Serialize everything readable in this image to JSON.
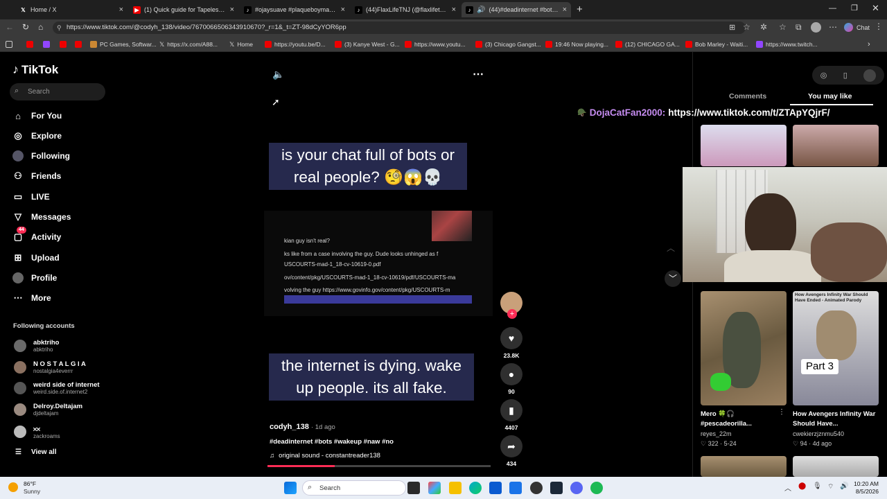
{
  "browser": {
    "tabs": [
      {
        "title": "Home / X",
        "icon": "x-logo-icon"
      },
      {
        "title": "(1) Quick guide for Tapeless Camc",
        "icon": "youtube-icon"
      },
      {
        "title": "#ojaysuave #plaqueboymaxedit #",
        "icon": "tiktok-icon"
      },
      {
        "title": "(44)FlaxLifeTNJ (@flaxlifetnj) | TikT",
        "icon": "tiktok-icon"
      },
      {
        "title": "(44)#deadinternet #bots #wa",
        "icon": "tiktok-icon"
      }
    ],
    "new_tab": "+",
    "url": "https://www.tiktok.com/@codyh_138/video/7670066506343910670?_r=1&_t=ZT-98dCyYOR6pp",
    "chat_label": "Chat",
    "bookmarks": [
      "PC Games, Softwar...",
      "https://x.com/A88...",
      "Home",
      "https://youtu.be/D...",
      "(3) Kanye West - G...",
      "https://www.youtu...",
      "(3) Chicago Gangst...",
      "19:46 Now playing...",
      "(12) CHICAGO GA...",
      "Bob Marley - Waiti...",
      "https://www.twitch..."
    ]
  },
  "tiktok": {
    "logo": "TikTok",
    "search_placeholder": "Search",
    "nav": [
      "For You",
      "Explore",
      "Following",
      "Friends",
      "LIVE",
      "Messages",
      "Activity",
      "Upload",
      "Profile",
      "More"
    ],
    "activity_badge": "44",
    "following_header": "Following accounts",
    "accounts": [
      {
        "name": "abktriho",
        "handle": "abktriho"
      },
      {
        "name": "N O S T A L G I A",
        "handle": "nostalgia4everrr"
      },
      {
        "name": "weird side of internet",
        "handle": "weird.side.of.internet2"
      },
      {
        "name": "Delroy.Deltajam",
        "handle": "djdeltajam"
      },
      {
        "name": "𐄂𐄂",
        "handle": "zackroams"
      }
    ],
    "view_all": "View all"
  },
  "video": {
    "caption_top": "is your chat full of bots or real people? 🧐😱💀",
    "caption_bottom": "the internet is dying. wake up people. its all fake.",
    "screen_lines": [
      "kian guy isn't real?",
      "ks like from a case involving the guy. Dude looks unhinged as f",
      "USCOURTS-mad-1_18-cv-10619-0.pdf",
      "ov/content/pkg/USCOURTS-mad-1_18-cv-10619/pdf/USCOURTS-ma",
      "volving the guy https://www.govinfo.gov/content/pkg/USCOURTS-m"
    ],
    "author": "codyh_138",
    "age": "· 1d ago",
    "hashtags": "#deadinternet #bots #wakeup #naw #no",
    "sound": "original sound - constantreader138",
    "progress": 0.3,
    "likes": "23.8K",
    "comments": "90",
    "saves": "4407",
    "shares": "434"
  },
  "right": {
    "tabs": [
      "Comments",
      "You may like"
    ],
    "chat_user": "DojaCatFan2000:",
    "chat_msg": "https://www.tiktok.com/t/ZTApYQjrF/",
    "cards": [
      {
        "title": "Mero 🍀🎧 #pescadeorilla...",
        "author": "reyes_22m",
        "stats": "♡ 322 · 5-24"
      },
      {
        "title": "How Avengers Infinity War Should Have...",
        "author": "cwekierzjznmu540",
        "stats": "♡ 94 · 4d ago",
        "thumb_top": "How Avengers Infinity War Should Have Ended - Animated Parody",
        "thumb_label": "Part 3"
      }
    ]
  },
  "taskbar": {
    "weather_temp": "86°F",
    "weather_desc": "Sunny",
    "search": "Search",
    "time": "10:20 AM",
    "date": "8/5/2026"
  }
}
